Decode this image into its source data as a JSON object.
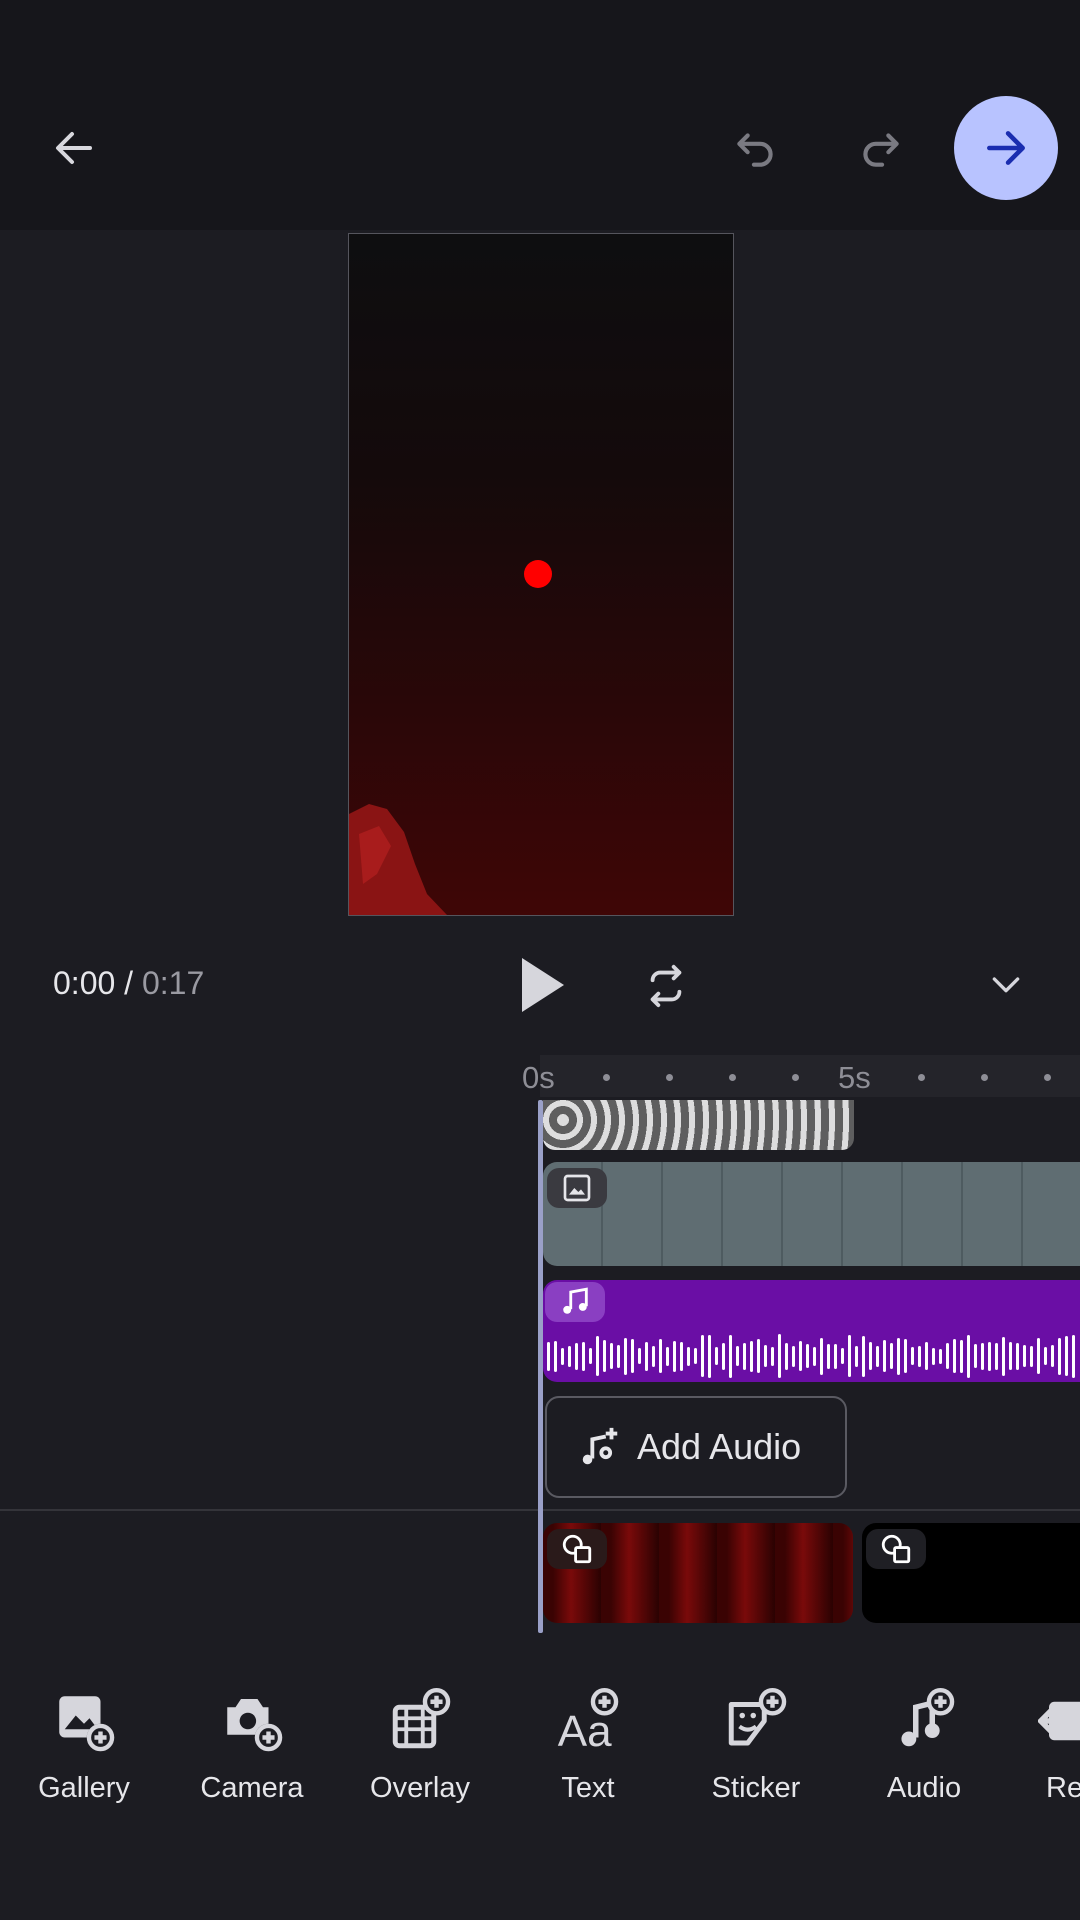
{
  "playback": {
    "current_time": "0:00",
    "separator": " / ",
    "total_time": "0:17"
  },
  "timeline": {
    "ruler_labels": [
      "0s",
      "5s"
    ]
  },
  "add_audio_label": "Add Audio",
  "toolbar": [
    {
      "label": "Gallery",
      "icon": "gallery-add-icon"
    },
    {
      "label": "Camera",
      "icon": "camera-add-icon"
    },
    {
      "label": "Overlay",
      "icon": "overlay-add-icon"
    },
    {
      "label": "Text",
      "icon": "text-add-icon"
    },
    {
      "label": "Sticker",
      "icon": "sticker-add-icon"
    },
    {
      "label": "Audio",
      "icon": "audio-add-icon"
    },
    {
      "label": "Rec",
      "icon": "record-icon"
    }
  ],
  "colors": {
    "accent": "#b8c3ff",
    "audio_track": "#6a0ea5",
    "record_dot": "#ff0000"
  }
}
